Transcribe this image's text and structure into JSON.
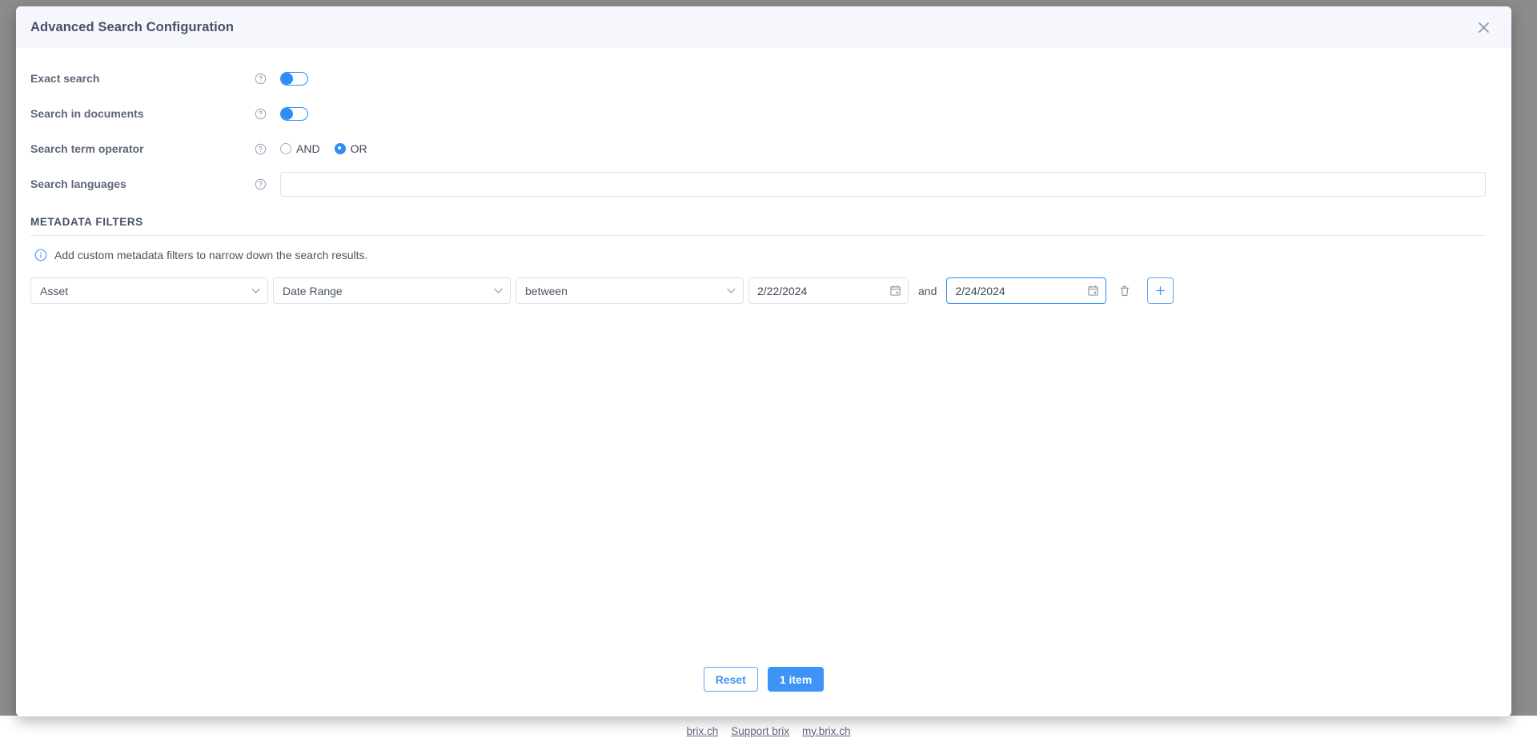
{
  "modal": {
    "title": "Advanced Search Configuration",
    "close_icon": "close-icon"
  },
  "settings": [
    {
      "label": "Exact search",
      "help_icon": "question-circle-icon",
      "control": "toggle",
      "value": "on"
    },
    {
      "label": "Search in documents",
      "help_icon": "question-circle-icon",
      "control": "toggle",
      "value": "on"
    },
    {
      "label": "Search term operator",
      "help_icon": "question-circle-icon",
      "control": "radio",
      "options": [
        "AND",
        "OR"
      ],
      "selected": "OR"
    },
    {
      "label": "Search languages",
      "help_icon": "question-circle-icon",
      "control": "input",
      "value": "",
      "placeholder": ""
    }
  ],
  "metadata": {
    "section_title": "METADATA FILTERS",
    "hint_icon": "info-circle-icon",
    "hint_text": "Add custom metadata filters to narrow down the search results.",
    "filter": {
      "asset": "Asset",
      "field": "Date Range",
      "operator": "between",
      "date_from": "2/22/2024",
      "conjunction": "and",
      "date_to": "2/24/2024",
      "delete_icon": "trash-icon",
      "add_icon": "plus-icon",
      "calendar_icon": "calendar-icon",
      "chevron_icon": "chevron-down-icon"
    }
  },
  "footer": {
    "reset_label": "Reset",
    "apply_label": "1 item"
  },
  "page_footer": {
    "links": [
      "brix.ch",
      "Support brix",
      "my.brix.ch"
    ]
  },
  "colors": {
    "accent": "#3d94f6",
    "header_bg": "#f6f7fd",
    "label": "#5d6778",
    "border": "#dde1ea"
  }
}
